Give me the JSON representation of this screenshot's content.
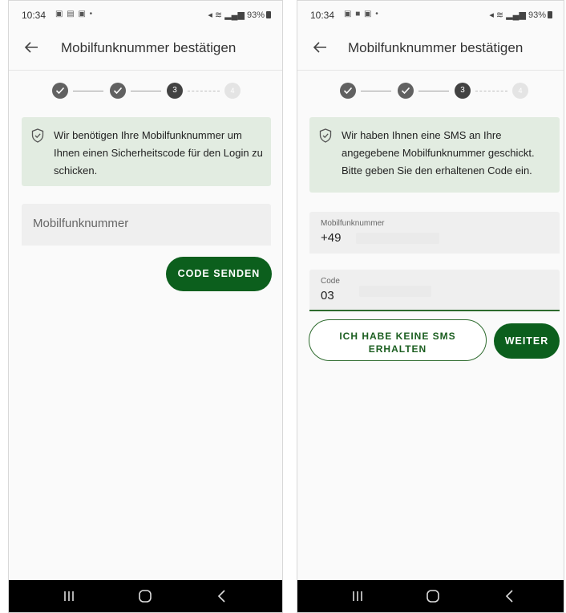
{
  "colors": {
    "accent": "#0c5f1d",
    "info_bg": "#e2ece1",
    "nav_bg": "#000000"
  },
  "screens": [
    {
      "status": {
        "time": "10:34",
        "battery": "93%"
      },
      "title": "Mobilfunknummer bestätigen",
      "stepper": {
        "steps": [
          "done",
          "done",
          "3",
          "4"
        ]
      },
      "info_text": "Wir benötigen Ihre Mobilfunknummer um Ihnen einen Sicherheitscode für den Login zu schicken.",
      "phone_placeholder": "Mobilfunknummer",
      "send_button": "CODE SENDEN"
    },
    {
      "status": {
        "time": "10:34",
        "battery": "93%"
      },
      "title": "Mobilfunknummer bestätigen",
      "stepper": {
        "steps": [
          "done",
          "done",
          "3",
          "4"
        ]
      },
      "info_text": "Wir haben Ihnen eine SMS an Ihre angegebene Mobilfunknummer geschickt. Bitte geben Sie den erhaltenen Code ein.",
      "phone_field": {
        "label": "Mobilfunknummer",
        "value": "+49"
      },
      "code_field": {
        "label": "Code",
        "value": "03"
      },
      "no_sms_button": "ICH HABE KEINE SMS ERHALTEN",
      "next_button": "WEITER"
    }
  ],
  "nav": {
    "icons": [
      "recent-apps-icon",
      "home-icon",
      "back-nav-icon"
    ]
  }
}
